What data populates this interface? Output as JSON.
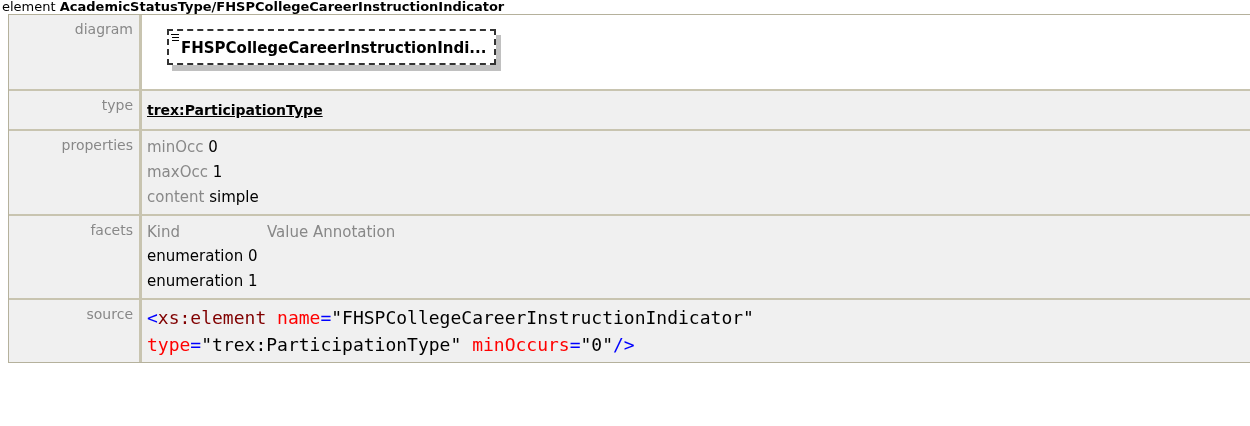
{
  "heading": {
    "prefix": "element",
    "path": "AcademicStatusType/FHSPCollegeCareerInstructionIndicator"
  },
  "rows": [
    {
      "kind": "diagram",
      "label": "diagram",
      "element": "FHSPCollegeCareerInstructionIndi..."
    },
    {
      "kind": "type",
      "label": "type",
      "value": "trex:ParticipationType"
    },
    {
      "kind": "properties",
      "label": "properties",
      "items": [
        {
          "name": "minOcc",
          "value": "0"
        },
        {
          "name": "maxOcc",
          "value": "1"
        },
        {
          "name": "content",
          "value": "simple"
        }
      ]
    },
    {
      "kind": "facets",
      "label": "facets",
      "columns": [
        "Kind",
        "Value Annotation"
      ],
      "items": [
        {
          "name": "enumeration",
          "value": "0"
        },
        {
          "name": "enumeration",
          "value": "1"
        }
      ]
    },
    {
      "kind": "source",
      "label": "source",
      "lines": [
        [
          {
            "kind": "punct",
            "s": "<"
          },
          {
            "kind": "tag",
            "s": "xs:element"
          },
          {
            "kind": "attr",
            "s": "name"
          },
          {
            "kind": "punct",
            "s": "="
          },
          {
            "kind": "value",
            "s": "\"FHSPCollegeCareerInstructionIndicator\""
          }
        ],
        [
          {
            "kind": "attr",
            "s": "type"
          },
          {
            "kind": "punct",
            "s": "="
          },
          {
            "kind": "value",
            "s": "\"trex:ParticipationType\""
          },
          {
            "kind": "attr",
            "s": "minOccurs"
          },
          {
            "kind": "punct",
            "s": "="
          },
          {
            "kind": "value",
            "s": "\"0\""
          },
          {
            "kind": "punct",
            "s": "/>"
          }
        ]
      ]
    }
  ]
}
